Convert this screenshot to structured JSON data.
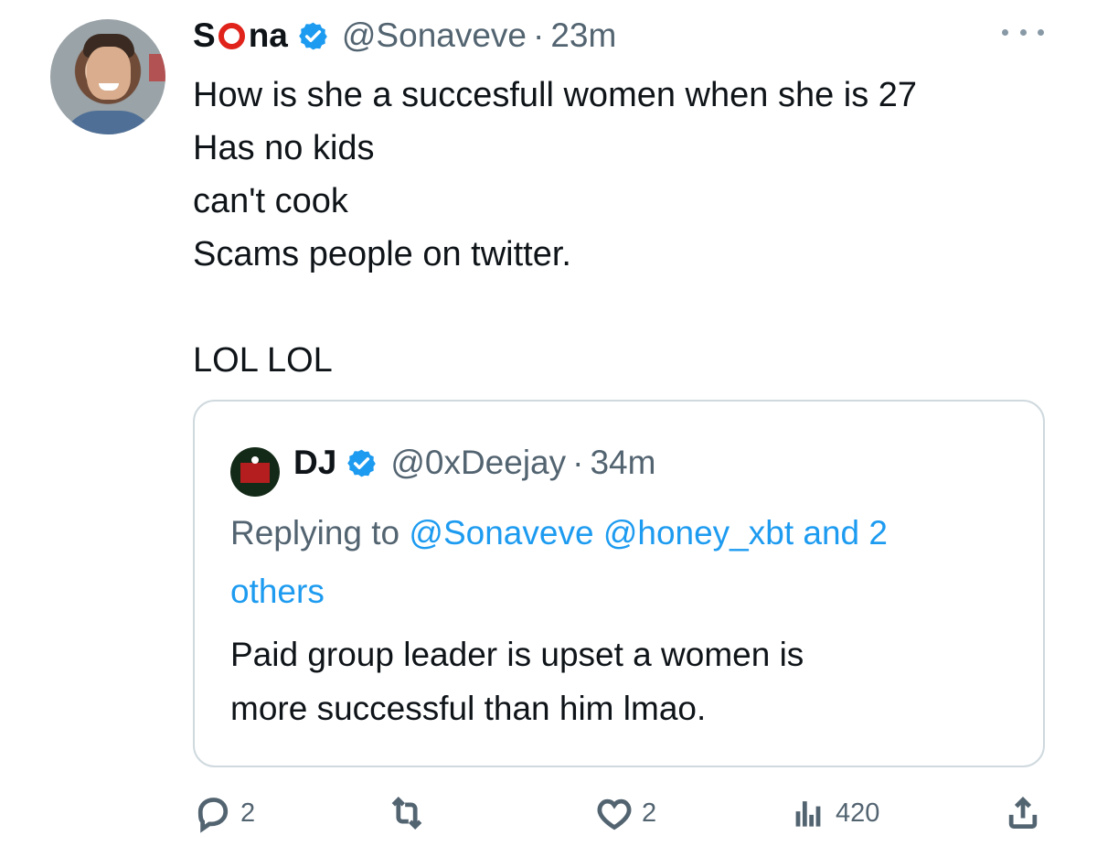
{
  "author": {
    "name_first": "S",
    "name_last": "na",
    "handle": "@Sonaveve",
    "separator": "·",
    "time": "23m"
  },
  "tweet": {
    "lines": [
      "How is she a succesfull women when she is 27",
      "Has no kids",
      "can't cook",
      "Scams people on twitter.",
      "",
      "LOL LOL"
    ]
  },
  "quote": {
    "name": "DJ",
    "handle": "@0xDeejay",
    "separator": "·",
    "time": "34m",
    "replying_prefix": "Replying to",
    "mention_1": "@Sonaveve",
    "mention_2": "@honey_xbt",
    "mention_and": "and 2",
    "mention_others": "others",
    "text_line_1": "Paid group leader is upset a women is",
    "text_line_2": "more successful than him lmao."
  },
  "actions": {
    "replies": "2",
    "likes": "2",
    "views": "420"
  },
  "colors": {
    "accent": "#1d9bf0",
    "muted": "#536471",
    "border": "#cfd9de",
    "brand_red": "#e0231b"
  }
}
